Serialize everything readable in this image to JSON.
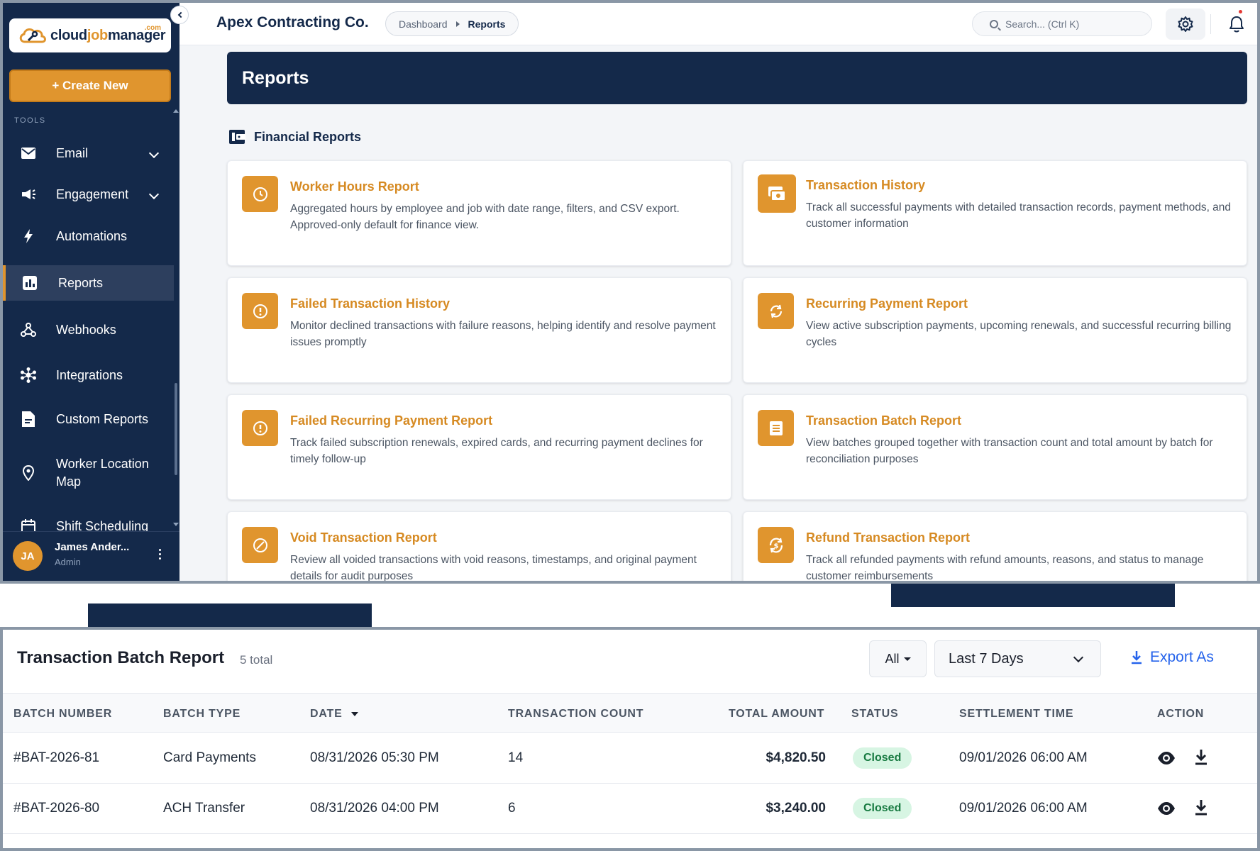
{
  "app": {
    "logo_text_a": "cloud",
    "logo_text_b": "job",
    "logo_text_c": "manager",
    "logo_com": ".com",
    "create_label": "+ Create New",
    "tools_label": "TOOLS",
    "nav": [
      {
        "label": "Email",
        "icon": "mail-icon",
        "chevron": true
      },
      {
        "label": "Engagement",
        "icon": "megaphone-icon",
        "chevron": true
      },
      {
        "label": "Automations",
        "icon": "lightning-icon",
        "chevron": false
      },
      {
        "label": "Reports",
        "icon": "bar-chart-icon",
        "chevron": false,
        "active": true
      },
      {
        "label": "Webhooks",
        "icon": "webhook-icon",
        "chevron": false
      },
      {
        "label": "Integrations",
        "icon": "network-icon",
        "chevron": false
      },
      {
        "label": "Custom Reports",
        "icon": "document-icon",
        "chevron": false
      },
      {
        "label": "Worker Location Map",
        "icon": "location-pin-icon",
        "chevron": false
      },
      {
        "label": "Shift Scheduling",
        "icon": "calendar-icon",
        "chevron": false
      }
    ],
    "user": {
      "initials": "JA",
      "name": "James Ander...",
      "role": "Admin"
    }
  },
  "header": {
    "company": "Apex Contracting Co.",
    "breadcrumb": [
      "Dashboard",
      "Reports"
    ],
    "search_placeholder": "Search... (Ctrl K)"
  },
  "page": {
    "banner_title": "Reports",
    "section_title": "Financial Reports",
    "cards": [
      {
        "title": "Worker Hours Report",
        "desc": "Aggregated hours by employee and job with date range, filters, and CSV export. Approved-only default for finance view.",
        "icon": "clock-icon"
      },
      {
        "title": "Transaction History",
        "desc": "Track all successful payments with detailed transaction records, payment methods, and customer information",
        "icon": "cash-icon"
      },
      {
        "title": "Failed Transaction History",
        "desc": "Monitor declined transactions with failure reasons, helping identify and resolve payment issues promptly",
        "icon": "alert-circle-icon"
      },
      {
        "title": "Recurring Payment Report",
        "desc": "View active subscription payments, upcoming renewals, and successful recurring billing cycles",
        "icon": "refresh-icon"
      },
      {
        "title": "Failed Recurring Payment Report",
        "desc": "Track failed subscription renewals, expired cards, and recurring payment declines for timely follow-up",
        "icon": "alert-circle-icon"
      },
      {
        "title": "Transaction Batch Report",
        "desc": "View batches grouped together with transaction count and total amount by batch for reconciliation purposes",
        "icon": "list-icon"
      },
      {
        "title": "Void Transaction Report",
        "desc": "Review all voided transactions with void reasons, timestamps, and original payment details for audit purposes",
        "icon": "block-icon"
      },
      {
        "title": "Refund Transaction Report",
        "desc": "Track all refunded payments with refund amounts, reasons, and status to manage customer reimbursements",
        "icon": "refund-icon"
      }
    ]
  },
  "batch": {
    "title": "Transaction Batch Report",
    "count": "5 total",
    "filter_all": "All",
    "range": "Last 7 Days",
    "export": "Export As",
    "columns": [
      "BATCH NUMBER",
      "BATCH TYPE",
      "DATE",
      "TRANSACTION COUNT",
      "TOTAL AMOUNT",
      "STATUS",
      "SETTLEMENT TIME",
      "ACTION"
    ],
    "rows": [
      {
        "batch": "#BAT-2026-81",
        "type": "Card Payments",
        "date": "08/31/2026 05:30 PM",
        "count": "14",
        "amount": "$4,820.50",
        "status": "Closed",
        "settlement": "09/01/2026 06:00 AM"
      },
      {
        "batch": "#BAT-2026-80",
        "type": "ACH Transfer",
        "date": "08/31/2026 04:00 PM",
        "count": "6",
        "amount": "$3,240.00",
        "status": "Closed",
        "settlement": "09/01/2026 06:00 AM"
      }
    ]
  },
  "colors": {
    "navy": "#14294a",
    "accent": "#e0952e",
    "link": "#2563eb",
    "success_bg": "#d7f5e3",
    "success_text": "#177a41"
  }
}
